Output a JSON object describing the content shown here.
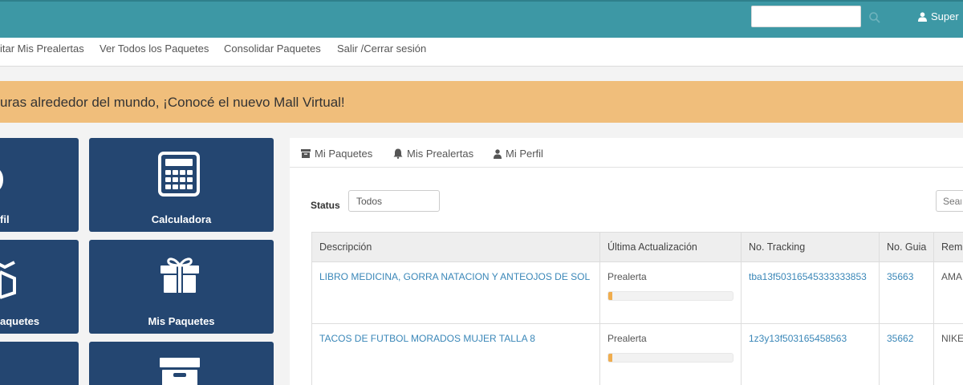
{
  "topbar": {
    "search_placeholder": "",
    "user_name": "Super"
  },
  "nav": {
    "items": [
      {
        "label": "itar Mis Prealertas"
      },
      {
        "label": "Ver Todos los Paquetes"
      },
      {
        "label": "Consolidar Paquetes"
      },
      {
        "label": "Salir /Cerrar sesión"
      }
    ]
  },
  "banner": {
    "text": "uras alrededor del mundo, ¡Conocé el nuevo Mall Virtual!"
  },
  "tiles": {
    "perfil": {
      "label": "fil",
      "icon": "user-icon"
    },
    "calculadora": {
      "label": "Calculadora",
      "icon": "calculator-icon"
    },
    "paquetes": {
      "label": "aquetes",
      "icon": "cube-icon"
    },
    "mis_paquetes": {
      "label": "Mis Paquetes",
      "icon": "gift-icon"
    },
    "archive": {
      "icon": "archive-icon"
    }
  },
  "panel": {
    "tabs": [
      {
        "label": "Mi Paquetes",
        "icon": "archive-icon"
      },
      {
        "label": "Mis Prealertas",
        "icon": "bell-icon"
      },
      {
        "label": "Mi Perfil",
        "icon": "user-icon"
      }
    ],
    "status_label": "Status",
    "status_value": "Todos",
    "search_placeholder": "Sear"
  },
  "table": {
    "headers": [
      "Descripción",
      "Última Actualización",
      "No. Tracking",
      "No. Guia",
      "Rem"
    ],
    "rows": [
      {
        "descripcion": "LIBRO MEDICINA, GORRA NATACION Y ANTEOJOS DE SOL",
        "estado": "Prealerta",
        "progress_percent": 3,
        "tracking": "tba13f50316545333333853",
        "guia": "35663",
        "rem": "AMA"
      },
      {
        "descripcion": "TACOS DE FUTBOL MORADOS MUJER TALLA 8",
        "estado": "Prealerta",
        "progress_percent": 3,
        "tracking": "1z3y13f503165458563",
        "guia": "35662",
        "rem": "NIKE"
      }
    ]
  },
  "colors": {
    "topbar": "#3d98a5",
    "banner": "#f0be7b",
    "tile": "#244671",
    "link": "#3a87b8",
    "progress": "#f0ad4e"
  }
}
